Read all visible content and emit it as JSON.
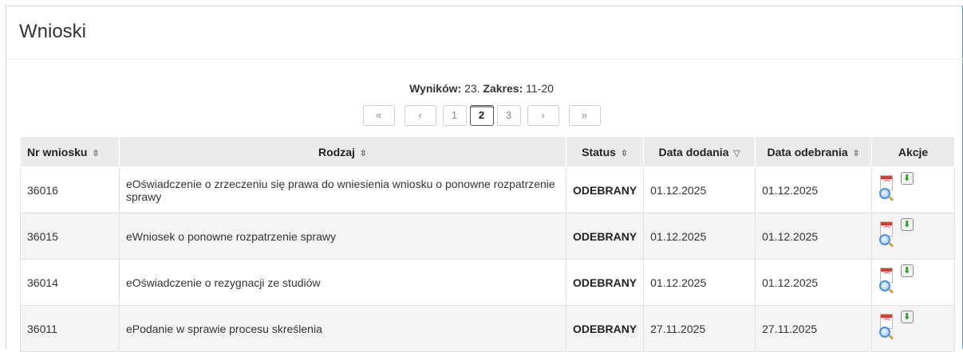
{
  "panel": {
    "title": "Wnioski"
  },
  "results": {
    "label_count": "Wyników:",
    "count": "23.",
    "label_range": "Zakres:",
    "range": "11-20"
  },
  "pager": {
    "first": "«",
    "prev": "‹",
    "pages": [
      "1",
      "2",
      "3"
    ],
    "next": "›",
    "last": "»",
    "active_page": "2"
  },
  "table": {
    "headers": {
      "nr": "Nr wniosku",
      "rodzaj": "Rodzaj",
      "status": "Status",
      "data_dodania": "Data dodania",
      "data_odebrania": "Data odebrania",
      "akcje": "Akcje"
    },
    "sort_icons": {
      "neutral": "⇳",
      "desc": "▽"
    },
    "rows": [
      {
        "nr": "36016",
        "rodzaj": "eOświadczenie o zrzeczeniu się prawa do wniesienia wniosku o ponowne rozpatrzenie sprawy",
        "status": "ODEBRANY",
        "data_dodania": "01.12.2025",
        "data_odebrania": "01.12.2025"
      },
      {
        "nr": "36015",
        "rodzaj": "eWniosek o ponowne rozpatrzenie sprawy",
        "status": "ODEBRANY",
        "data_dodania": "01.12.2025",
        "data_odebrania": "01.12.2025"
      },
      {
        "nr": "36014",
        "rodzaj": "eOświadczenie o rezygnacji ze studiów",
        "status": "ODEBRANY",
        "data_dodania": "01.12.2025",
        "data_odebrania": "01.12.2025"
      },
      {
        "nr": "36011",
        "rodzaj": "ePodanie w sprawie procesu skreślenia",
        "status": "ODEBRANY",
        "data_dodania": "27.11.2025",
        "data_odebrania": "27.11.2025"
      }
    ],
    "icons": {
      "preview": "pdf-preview-icon",
      "download": "download-icon"
    }
  },
  "colors": {
    "accent": "#5a9bd5",
    "header_bg": "#ebebeb",
    "row_alt": "#f4f4f4",
    "download_arrow": "#2e9a2e",
    "pdf_red": "#e23a2a"
  }
}
